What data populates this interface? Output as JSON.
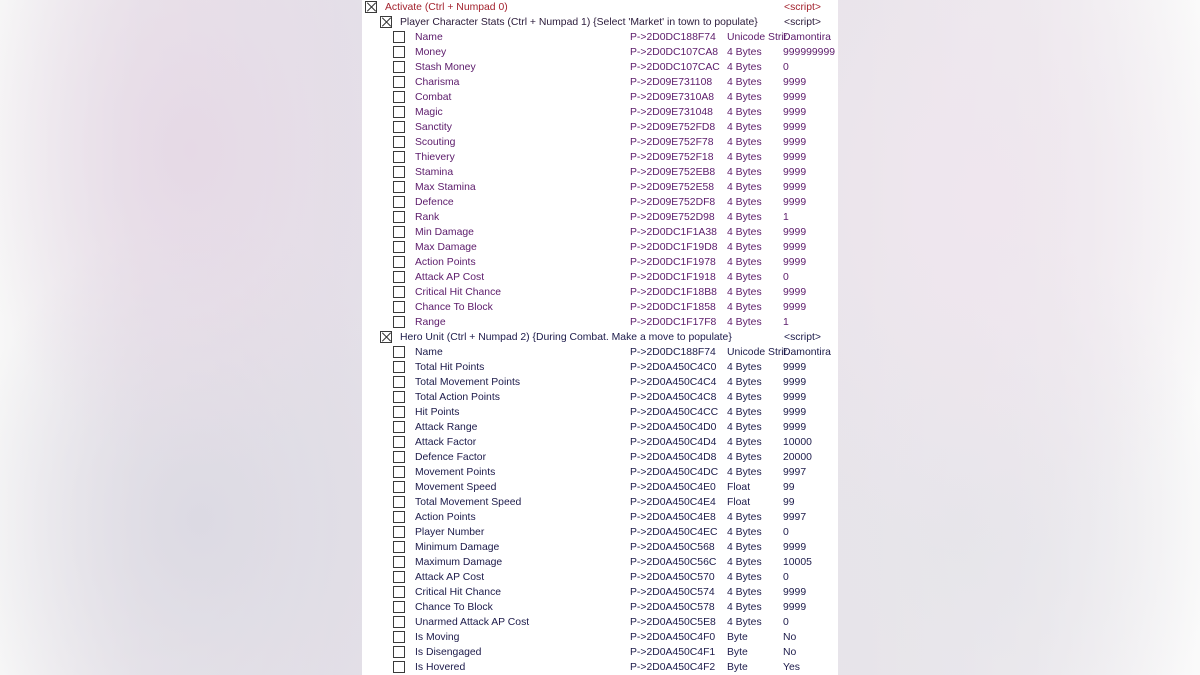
{
  "colors": {
    "activate_text": "#a3222e",
    "player_group_text": "#5b1a6a",
    "hero_group_text": "#1c1a4a"
  },
  "root": {
    "description": "Activate (Ctrl + Numpad 0)",
    "value": "<script>",
    "checked": true
  },
  "groups": [
    {
      "description": "Player Character Stats (Ctrl + Numpad 1) {Select 'Market' in town to populate}",
      "value": "<script>",
      "checked": true,
      "entries": [
        {
          "description": "Name",
          "address": "P->2D0DC188F74",
          "type": "Unicode Strir",
          "value": "Damontira"
        },
        {
          "description": "Money",
          "address": "P->2D0DC107CA8",
          "type": "4 Bytes",
          "value": "999999999"
        },
        {
          "description": "Stash Money",
          "address": "P->2D0DC107CAC",
          "type": "4 Bytes",
          "value": "0"
        },
        {
          "description": "Charisma",
          "address": "P->2D09E731108",
          "type": "4 Bytes",
          "value": "9999"
        },
        {
          "description": "Combat",
          "address": "P->2D09E7310A8",
          "type": "4 Bytes",
          "value": "9999"
        },
        {
          "description": "Magic",
          "address": "P->2D09E731048",
          "type": "4 Bytes",
          "value": "9999"
        },
        {
          "description": "Sanctity",
          "address": "P->2D09E752FD8",
          "type": "4 Bytes",
          "value": "9999"
        },
        {
          "description": "Scouting",
          "address": "P->2D09E752F78",
          "type": "4 Bytes",
          "value": "9999"
        },
        {
          "description": "Thievery",
          "address": "P->2D09E752F18",
          "type": "4 Bytes",
          "value": "9999"
        },
        {
          "description": "Stamina",
          "address": "P->2D09E752EB8",
          "type": "4 Bytes",
          "value": "9999"
        },
        {
          "description": "Max Stamina",
          "address": "P->2D09E752E58",
          "type": "4 Bytes",
          "value": "9999"
        },
        {
          "description": "Defence",
          "address": "P->2D09E752DF8",
          "type": "4 Bytes",
          "value": "9999"
        },
        {
          "description": "Rank",
          "address": "P->2D09E752D98",
          "type": "4 Bytes",
          "value": "1"
        },
        {
          "description": "Min Damage",
          "address": "P->2D0DC1F1A38",
          "type": "4 Bytes",
          "value": "9999"
        },
        {
          "description": "Max Damage",
          "address": "P->2D0DC1F19D8",
          "type": "4 Bytes",
          "value": "9999"
        },
        {
          "description": "Action Points",
          "address": "P->2D0DC1F1978",
          "type": "4 Bytes",
          "value": "9999"
        },
        {
          "description": "Attack AP Cost",
          "address": "P->2D0DC1F1918",
          "type": "4 Bytes",
          "value": "0"
        },
        {
          "description": "Critical Hit Chance",
          "address": "P->2D0DC1F18B8",
          "type": "4 Bytes",
          "value": "9999"
        },
        {
          "description": "Chance To Block",
          "address": "P->2D0DC1F1858",
          "type": "4 Bytes",
          "value": "9999"
        },
        {
          "description": "Range",
          "address": "P->2D0DC1F17F8",
          "type": "4 Bytes",
          "value": "1"
        }
      ]
    },
    {
      "description": "Hero Unit (Ctrl + Numpad 2) {During Combat. Make a move to populate}",
      "value": "<script>",
      "checked": true,
      "entries": [
        {
          "description": "Name",
          "address": "P->2D0DC188F74",
          "type": "Unicode Strir",
          "value": "Damontira"
        },
        {
          "description": "Total Hit Points",
          "address": "P->2D0A450C4C0",
          "type": "4 Bytes",
          "value": "9999"
        },
        {
          "description": "Total Movement Points",
          "address": "P->2D0A450C4C4",
          "type": "4 Bytes",
          "value": "9999"
        },
        {
          "description": "Total Action Points",
          "address": "P->2D0A450C4C8",
          "type": "4 Bytes",
          "value": "9999"
        },
        {
          "description": "Hit Points",
          "address": "P->2D0A450C4CC",
          "type": "4 Bytes",
          "value": "9999"
        },
        {
          "description": "Attack Range",
          "address": "P->2D0A450C4D0",
          "type": "4 Bytes",
          "value": "9999"
        },
        {
          "description": "Attack Factor",
          "address": "P->2D0A450C4D4",
          "type": "4 Bytes",
          "value": "10000"
        },
        {
          "description": "Defence Factor",
          "address": "P->2D0A450C4D8",
          "type": "4 Bytes",
          "value": "20000"
        },
        {
          "description": "Movement Points",
          "address": "P->2D0A450C4DC",
          "type": "4 Bytes",
          "value": "9997"
        },
        {
          "description": "Movement Speed",
          "address": "P->2D0A450C4E0",
          "type": "Float",
          "value": "99"
        },
        {
          "description": "Total Movement Speed",
          "address": "P->2D0A450C4E4",
          "type": "Float",
          "value": "99"
        },
        {
          "description": "Action Points",
          "address": "P->2D0A450C4E8",
          "type": "4 Bytes",
          "value": "9997"
        },
        {
          "description": "Player Number",
          "address": "P->2D0A450C4EC",
          "type": "4 Bytes",
          "value": "0"
        },
        {
          "description": "Minimum Damage",
          "address": "P->2D0A450C568",
          "type": "4 Bytes",
          "value": "9999"
        },
        {
          "description": "Maximum Damage",
          "address": "P->2D0A450C56C",
          "type": "4 Bytes",
          "value": "10005"
        },
        {
          "description": "Attack AP Cost",
          "address": "P->2D0A450C570",
          "type": "4 Bytes",
          "value": "0"
        },
        {
          "description": "Critical Hit Chance",
          "address": "P->2D0A450C574",
          "type": "4 Bytes",
          "value": "9999"
        },
        {
          "description": "Chance To Block",
          "address": "P->2D0A450C578",
          "type": "4 Bytes",
          "value": "9999"
        },
        {
          "description": "Unarmed Attack AP Cost",
          "address": "P->2D0A450C5E8",
          "type": "4 Bytes",
          "value": "0"
        },
        {
          "description": "Is Moving",
          "address": "P->2D0A450C4F0",
          "type": "Byte",
          "value": "No"
        },
        {
          "description": "Is Disengaged",
          "address": "P->2D0A450C4F1",
          "type": "Byte",
          "value": "No"
        },
        {
          "description": "Is Hovered",
          "address": "P->2D0A450C4F2",
          "type": "Byte",
          "value": "Yes"
        }
      ]
    }
  ]
}
